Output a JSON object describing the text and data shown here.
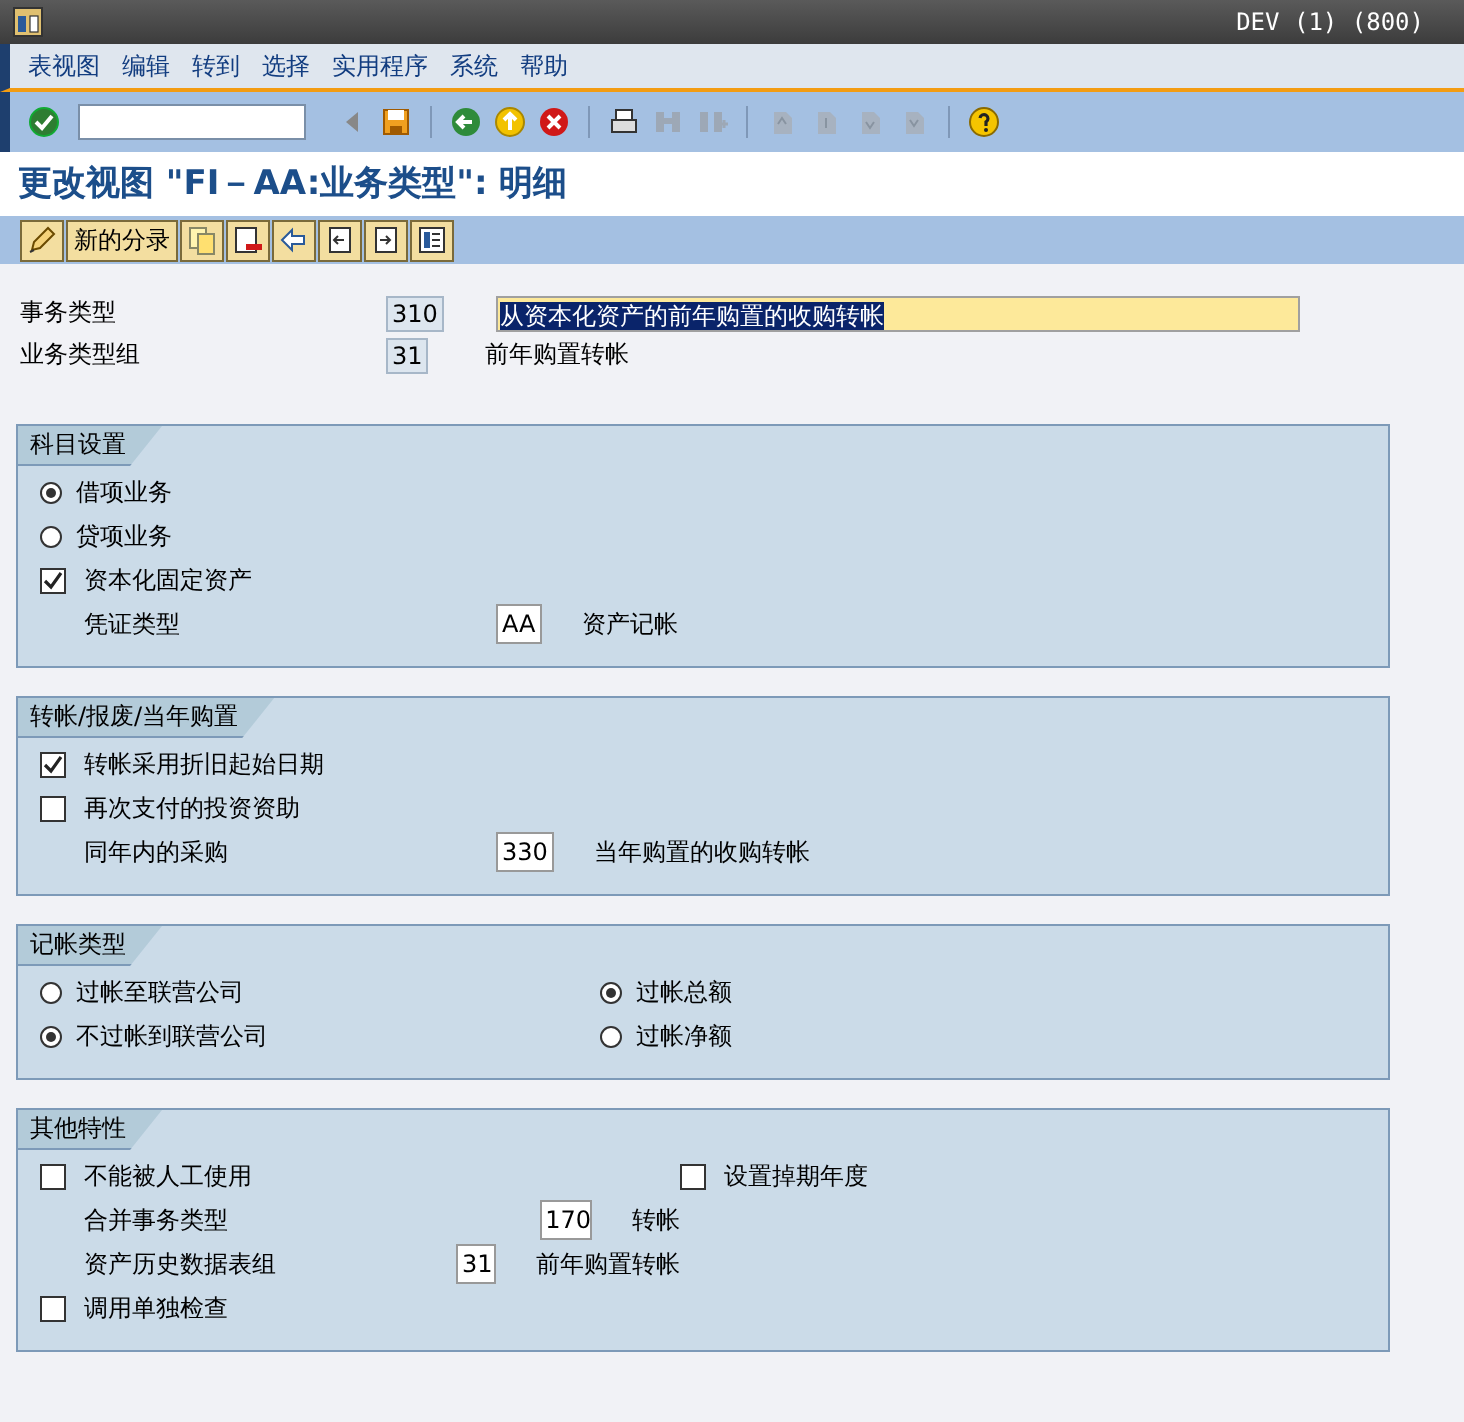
{
  "window": {
    "title": "DEV (1) (800)"
  },
  "menu": [
    "表视图",
    "编辑",
    "转到",
    "选择",
    "实用程序",
    "系统",
    "帮助"
  ],
  "toolbar": {
    "buttons": [
      {
        "disabled": false
      },
      {
        "disabled": false
      },
      {
        "disabled": false
      },
      {
        "disabled": false
      },
      {
        "disabled": false
      },
      {
        "disabled": false
      },
      {
        "disabled": false
      },
      {
        "disabled": true
      },
      {
        "disabled": true
      },
      {
        "disabled": true
      },
      {
        "disabled": true
      },
      {
        "disabled": true
      },
      {
        "disabled": true
      },
      {
        "disabled": false
      }
    ]
  },
  "page_title": "更改视图 \"FI－AA:业务类型\": 明细",
  "app_toolbar": [
    {
      "kind": "icon"
    },
    {
      "kind": "text",
      "label": "新的分录"
    },
    {
      "kind": "icon"
    },
    {
      "kind": "icon"
    },
    {
      "kind": "icon"
    },
    {
      "kind": "icon"
    },
    {
      "kind": "icon"
    },
    {
      "kind": "icon"
    }
  ],
  "header_fields": [
    {
      "label": "事务类型",
      "code": "310",
      "description": "从资本化资产的前年购置的收购转帐",
      "kind": "field",
      "selected": true
    },
    {
      "label": "业务类型组",
      "code": "31",
      "description": "前年购置转帐",
      "kind": "text",
      "selected": false
    }
  ],
  "groups": [
    {
      "title": "科目设置",
      "rows": [
        [
          {
            "kind": "radio",
            "label": "借项业务",
            "selected": true
          }
        ],
        [
          {
            "kind": "radio",
            "label": "贷项业务",
            "selected": false
          }
        ],
        [
          {
            "kind": "checkbox",
            "label": "资本化固定资产",
            "checked": true
          }
        ],
        [
          {
            "kind": "field",
            "label": "凭证类型",
            "value": "AA",
            "description": "资产记帐"
          }
        ]
      ]
    },
    {
      "title": "转帐/报废/当年购置",
      "rows": [
        [
          {
            "kind": "checkbox",
            "label": "转帐采用折旧起始日期",
            "checked": true
          }
        ],
        [
          {
            "kind": "checkbox",
            "label": "再次支付的投资资助",
            "checked": false
          }
        ],
        [
          {
            "kind": "field",
            "label": "同年内的采购",
            "value": "330",
            "description": "当年购置的收购转帐"
          }
        ]
      ]
    },
    {
      "title": "记帐类型",
      "rows": [
        [
          {
            "kind": "radio",
            "label": "过帐至联营公司",
            "selected": false
          },
          {
            "kind": "radio",
            "label": "过帐总额",
            "selected": true
          }
        ],
        [
          {
            "kind": "radio",
            "label": "不过帐到联营公司",
            "selected": true
          },
          {
            "kind": "radio",
            "label": "过帐净额",
            "selected": false
          }
        ]
      ]
    },
    {
      "title": "其他特性",
      "rows": [
        [
          {
            "kind": "checkbox",
            "label": "不能被人工使用",
            "checked": false
          },
          {
            "kind": "checkbox",
            "label": "设置掉期年度",
            "checked": false
          }
        ],
        [
          {
            "kind": "field",
            "label": "合并事务类型",
            "value": "170",
            "description": "转帐"
          }
        ],
        [
          {
            "kind": "field",
            "label": "资产历史数据表组",
            "value": "31",
            "description": "前年购置转帐"
          }
        ],
        [
          {
            "kind": "checkbox",
            "label": "调用单独检查",
            "checked": false
          }
        ]
      ]
    }
  ]
}
